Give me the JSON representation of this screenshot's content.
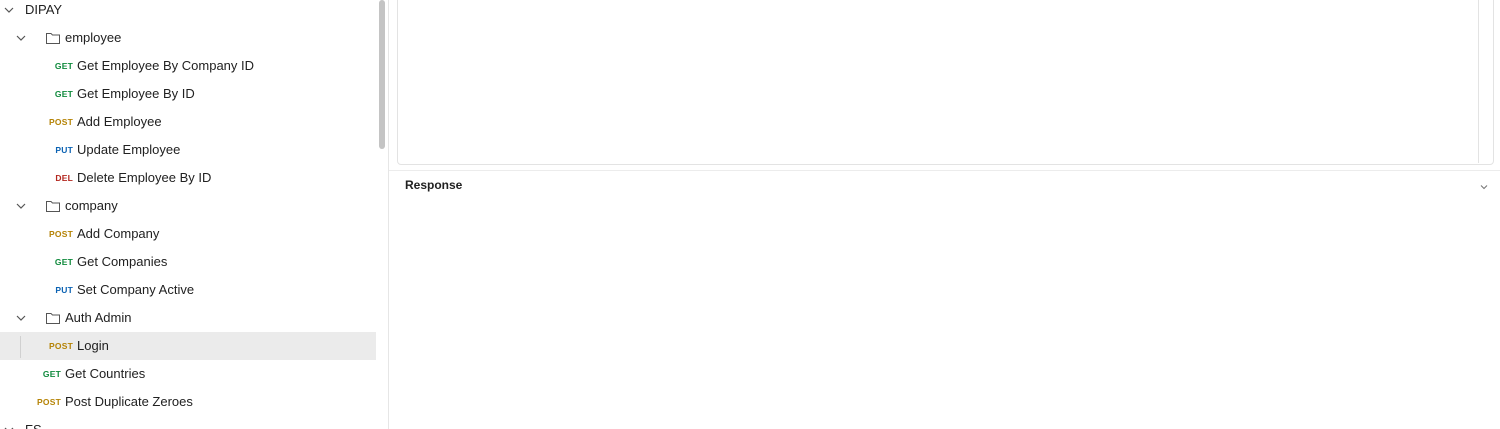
{
  "sidebar": {
    "collection": "DIPAY",
    "folders": {
      "employee": {
        "name": "employee",
        "items": [
          {
            "method": "GET",
            "label": "Get Employee By Company ID"
          },
          {
            "method": "GET",
            "label": "Get Employee By ID"
          },
          {
            "method": "POST",
            "label": "Add Employee"
          },
          {
            "method": "PUT",
            "label": "Update Employee"
          },
          {
            "method": "DEL",
            "label": "Delete Employee By ID"
          }
        ]
      },
      "company": {
        "name": "company",
        "items": [
          {
            "method": "POST",
            "label": "Add Company"
          },
          {
            "method": "GET",
            "label": "Get Companies"
          },
          {
            "method": "PUT",
            "label": "Set Company Active"
          }
        ]
      },
      "auth_admin": {
        "name": "Auth Admin",
        "items": [
          {
            "method": "POST",
            "label": "Login"
          }
        ]
      }
    },
    "root_items": [
      {
        "method": "GET",
        "label": "Get Countries"
      },
      {
        "method": "POST",
        "label": "Post Duplicate Zeroes"
      }
    ],
    "next_collection": "FS"
  },
  "main": {
    "response_title": "Response"
  },
  "colors": {
    "get": "#0f8a3c",
    "post": "#b58305",
    "put": "#0b62b3",
    "del": "#b3261e",
    "selected_row": "#ebebeb"
  }
}
